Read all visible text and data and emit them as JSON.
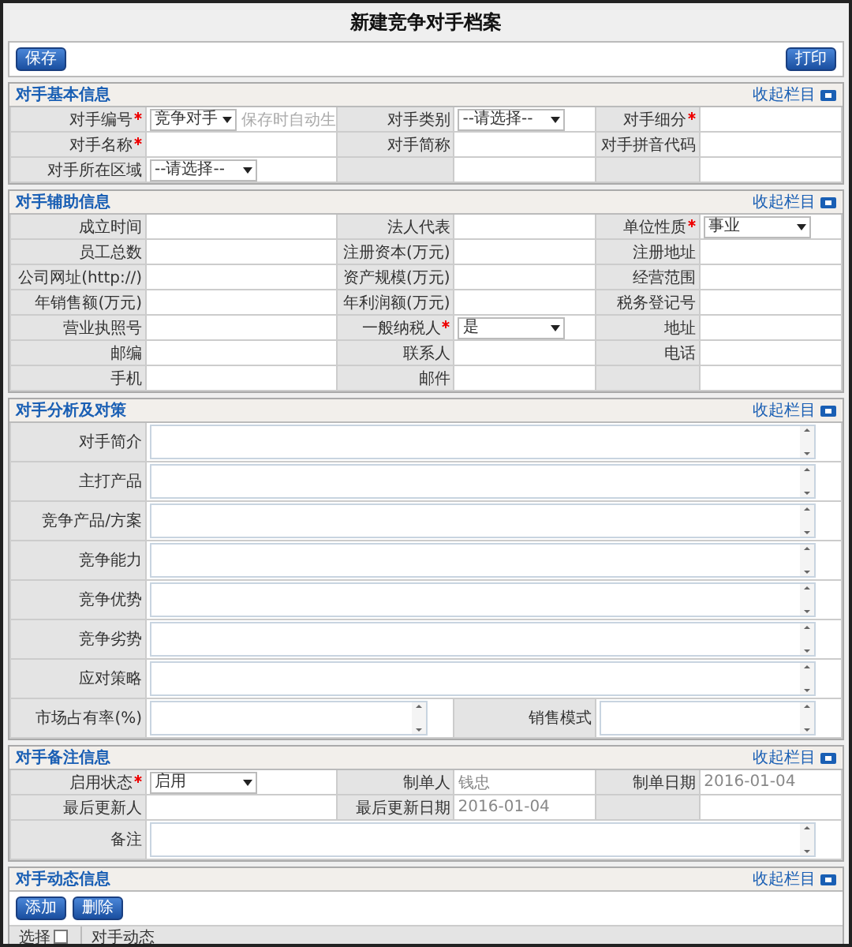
{
  "title": "新建竞争对手档案",
  "toolbar": {
    "left_button": "保存",
    "right_button": "打印"
  },
  "sections": [
    {
      "title": "对手基本信息",
      "collapse_label": "收起栏目",
      "kind": "form",
      "rows": [
        [
          {
            "kind": "select_hint",
            "label": "对手编号",
            "required": true,
            "value": "竞争对手",
            "hint": "保存时自动生"
          },
          {
            "kind": "select",
            "label": "对手类别",
            "required": false,
            "value": "--请选择--"
          },
          {
            "kind": "text",
            "label": "对手细分",
            "required": true
          }
        ],
        [
          {
            "kind": "text",
            "label": "对手名称",
            "required": true
          },
          {
            "kind": "text",
            "label": "对手简称",
            "required": false
          },
          {
            "kind": "text",
            "label": "对手拼音代码",
            "required": false
          }
        ],
        [
          {
            "kind": "select",
            "label": "对手所在区域",
            "required": false,
            "value": "--请选择--"
          },
          {
            "kind": "blank"
          },
          {
            "kind": "blank"
          }
        ]
      ]
    },
    {
      "title": "对手辅助信息",
      "collapse_label": "收起栏目",
      "kind": "form",
      "rows": [
        [
          {
            "kind": "text",
            "label": "成立时间",
            "required": false
          },
          {
            "kind": "text",
            "label": "法人代表",
            "required": false
          },
          {
            "kind": "select",
            "label": "单位性质",
            "required": true,
            "value": "事业"
          }
        ],
        [
          {
            "kind": "text",
            "label": "员工总数",
            "required": false
          },
          {
            "kind": "text",
            "label": "注册资本(万元)",
            "required": false
          },
          {
            "kind": "text",
            "label": "注册地址",
            "required": false
          }
        ],
        [
          {
            "kind": "text",
            "label": "公司网址(http://)",
            "required": false
          },
          {
            "kind": "text",
            "label": "资产规模(万元)",
            "required": false
          },
          {
            "kind": "text",
            "label": "经营范围",
            "required": false
          }
        ],
        [
          {
            "kind": "text",
            "label": "年销售额(万元)",
            "required": false
          },
          {
            "kind": "text",
            "label": "年利润额(万元)",
            "required": false
          },
          {
            "kind": "text",
            "label": "税务登记号",
            "required": false
          }
        ],
        [
          {
            "kind": "text",
            "label": "营业执照号",
            "required": false
          },
          {
            "kind": "select",
            "label": "一般纳税人",
            "required": true,
            "value": "是"
          },
          {
            "kind": "text",
            "label": "地址",
            "required": false
          }
        ],
        [
          {
            "kind": "text",
            "label": "邮编",
            "required": false
          },
          {
            "kind": "text",
            "label": "联系人",
            "required": false
          },
          {
            "kind": "text",
            "label": "电话",
            "required": false
          }
        ],
        [
          {
            "kind": "text",
            "label": "手机",
            "required": false
          },
          {
            "kind": "text",
            "label": "邮件",
            "required": false
          },
          {
            "kind": "blank"
          }
        ]
      ]
    },
    {
      "title": "对手分析及对策",
      "collapse_label": "收起栏目",
      "kind": "form",
      "rows": [
        [
          {
            "kind": "textarea_wide",
            "label": "对手简介",
            "required": false
          }
        ],
        [
          {
            "kind": "textarea_wide",
            "label": "主打产品",
            "required": false
          }
        ],
        [
          {
            "kind": "textarea_wide",
            "label": "竞争产品/方案",
            "required": false
          }
        ],
        [
          {
            "kind": "textarea_wide",
            "label": "竞争能力",
            "required": false
          }
        ],
        [
          {
            "kind": "textarea_wide",
            "label": "竞争优势",
            "required": false
          }
        ],
        [
          {
            "kind": "textarea_wide",
            "label": "竞争劣势",
            "required": false
          }
        ],
        [
          {
            "kind": "textarea_wide",
            "label": "应对策略",
            "required": false
          }
        ],
        [
          {
            "kind": "textarea_half",
            "label": "市场占有率(%)",
            "required": false
          },
          {
            "kind": "textarea_half",
            "label": "销售模式",
            "required": false
          }
        ]
      ]
    },
    {
      "title": "对手备注信息",
      "collapse_label": "收起栏目",
      "kind": "form",
      "rows": [
        [
          {
            "kind": "select",
            "label": "启用状态",
            "required": true,
            "value": "启用"
          },
          {
            "kind": "readonly",
            "label": "制单人",
            "required": false,
            "value": "钱忠"
          },
          {
            "kind": "readonly",
            "label": "制单日期",
            "required": false,
            "value": "2016-01-04"
          }
        ],
        [
          {
            "kind": "text",
            "label": "最后更新人",
            "required": false
          },
          {
            "kind": "readonly",
            "label": "最后更新日期",
            "required": false,
            "value": "2016-01-04"
          },
          {
            "kind": "blank"
          }
        ],
        [
          {
            "kind": "textarea_wide",
            "label": "备注",
            "required": false
          }
        ]
      ]
    },
    {
      "title": "对手动态信息",
      "collapse_label": "收起栏目",
      "kind": "list",
      "buttons": [
        "添加",
        "删除"
      ],
      "columns": [
        {
          "kind": "checkbox",
          "label": "选择",
          "checked": false
        },
        {
          "kind": "text",
          "label": "对手动态"
        }
      ]
    }
  ]
}
